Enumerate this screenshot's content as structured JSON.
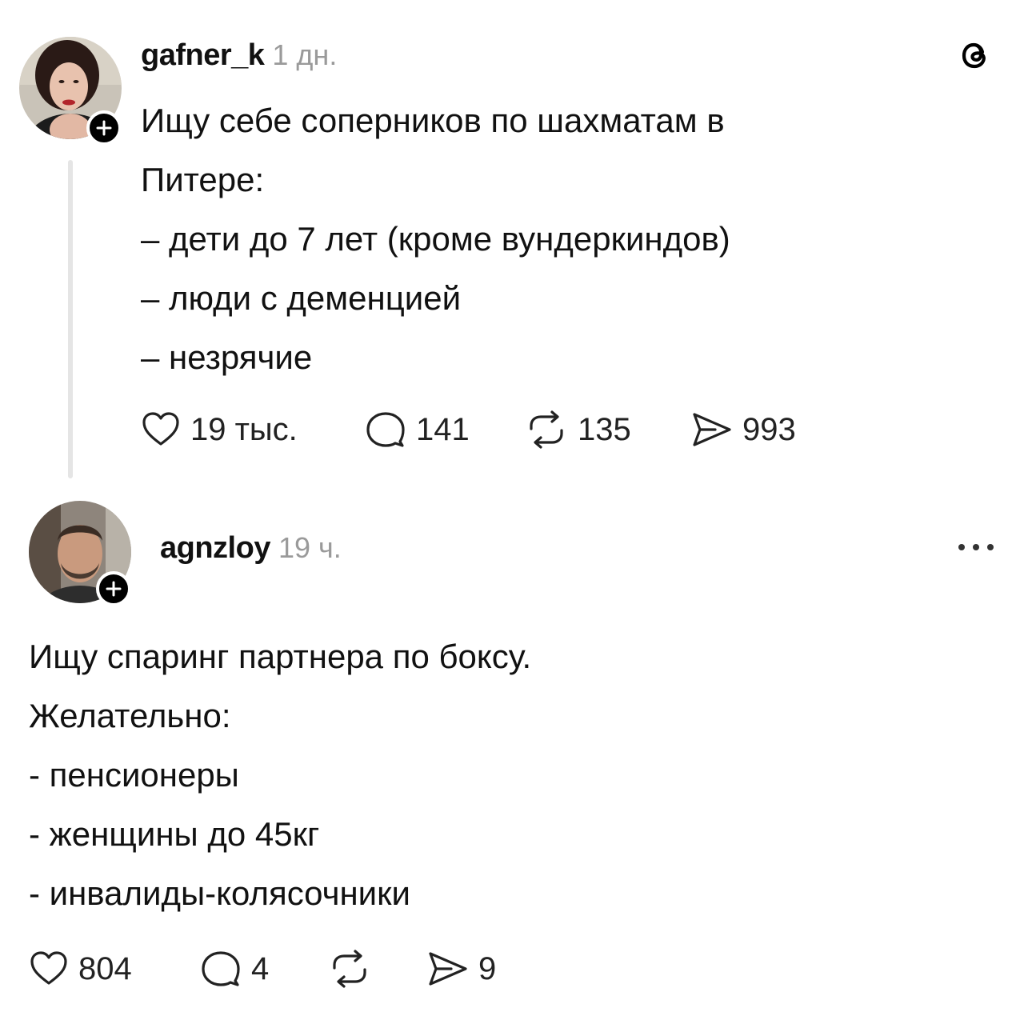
{
  "posts": [
    {
      "username": "gafner_k",
      "time": "1 дн.",
      "lines": [
        "Ищу себе соперников по шахматам в",
        "Питере:",
        "– дети до 7 лет (кроме вундеркиндов)",
        "– люди с деменцией",
        "– незрячие"
      ],
      "stats": {
        "likes": "19 тыс.",
        "comments": "141",
        "reposts": "135",
        "shares": "993"
      }
    },
    {
      "username": "agnzloy",
      "time": "19 ч.",
      "lines": [
        "Ищу спаринг партнера по боксу.",
        "Желательно:",
        "- пенсионеры",
        "- женщины до 45кг",
        "- инвалиды-колясочники"
      ],
      "stats": {
        "likes": "804",
        "comments": "4",
        "reposts": "",
        "shares": "9"
      }
    }
  ],
  "icons": {
    "app_logo": "threads-logo-icon",
    "more": "more-options-icon",
    "like": "heart-icon",
    "comment": "comment-bubble-icon",
    "repost": "repost-icon",
    "share": "send-icon",
    "follow": "plus-icon"
  },
  "colors": {
    "text": "#111111",
    "muted": "#9a9a9a",
    "divider": "#e5e5e5",
    "badge": "#000000"
  }
}
